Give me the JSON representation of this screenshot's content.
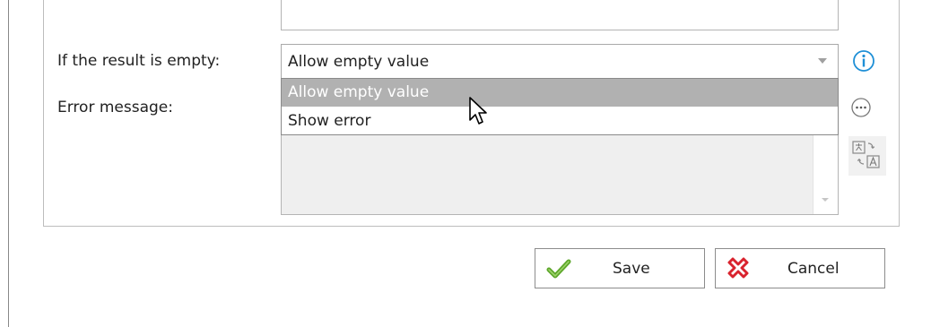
{
  "form": {
    "empty_result_label": "If the result is empty:",
    "error_message_label": "Error message:"
  },
  "empty_result_select": {
    "value": "Allow empty value",
    "options": [
      {
        "label": "Allow empty value",
        "state": "highlighted"
      },
      {
        "label": "Show error",
        "state": "normal"
      }
    ]
  },
  "side_icons": [
    "info-icon",
    "more-options-icon",
    "translate-icon"
  ],
  "buttons": {
    "save_label": "Save",
    "cancel_label": "Cancel"
  },
  "colors": {
    "info_blue": "#1e8fd6",
    "save_check_green": "#5ca62a",
    "cancel_red": "#d9232e",
    "option_highlight": "#b1b1b1"
  }
}
